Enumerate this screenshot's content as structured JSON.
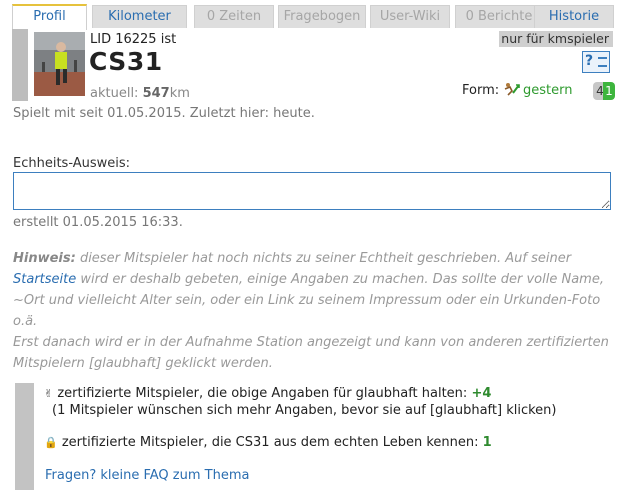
{
  "tabs": [
    {
      "label": "Profil",
      "state": "active"
    },
    {
      "label": "Kilometer",
      "state": "link"
    },
    {
      "label": "0 Zeiten",
      "state": "disabled"
    },
    {
      "label": "Fragebogen",
      "state": "disabled"
    },
    {
      "label": "User-Wiki",
      "state": "disabled"
    },
    {
      "label": "0 Berichte",
      "state": "disabled"
    },
    {
      "label": "Historie",
      "state": "link"
    }
  ],
  "profile": {
    "lid_text": "LID 16225 ist",
    "username": "CS31",
    "current_prefix": "aktuell:",
    "current_km": "547",
    "current_unit": "km",
    "only_badge": "nur für kmspieler",
    "help_icon": "help-book-icon",
    "form_label": "Form:",
    "form_icon": "runner-form-icon",
    "form_value": "gestern",
    "count_grey": "4",
    "count_green": "1"
  },
  "since_text": "Spielt mit seit 01.05.2015. Zuletzt hier: heute.",
  "echtheit": {
    "label": "Echheits-Ausweis:",
    "value": "",
    "created": "erstellt 01.05.2015 16:33."
  },
  "hint": {
    "label": "Hinweis:",
    "text_before_link": " dieser Mitspieler hat noch nichts zu seiner Echtheit geschrieben. Auf seiner ",
    "link": "Startseite",
    "text_after_link": " wird er deshalb gebeten, einige Angaben zu machen. Das sollte der volle Name, ~Ort und vielleicht Alter sein, oder ein Link zu seinem Impressum oder ein Urkunden-Foto o.ä.",
    "text_line2": "Erst danach wird er in der Aufnahme Station angezeigt und kann von anderen zertifizierten Mitspielern [glaubhaft] geklickt werden."
  },
  "certification": {
    "line1_text": "zertifizierte Mitspieler, die obige Angaben für glaubhaft halten: ",
    "line1_count": "+4",
    "line2_text": "(1 Mitspieler wünschen sich mehr Angaben, bevor sie auf [glaubhaft] klicken)",
    "line3_text": "zertifizierte Mitspieler, die CS31 aus dem echten Leben kennen: ",
    "line3_count": "1",
    "faq_link": "Fragen? kleine FAQ zum Thema",
    "hand_icon": "thumb-icon",
    "lock_icon": "lock-icon"
  }
}
